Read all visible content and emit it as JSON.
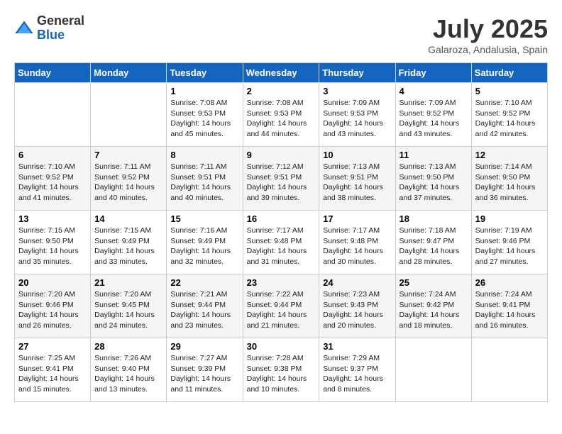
{
  "header": {
    "logo_line1": "General",
    "logo_line2": "Blue",
    "month": "July 2025",
    "location": "Galaroza, Andalusia, Spain"
  },
  "columns": [
    "Sunday",
    "Monday",
    "Tuesday",
    "Wednesday",
    "Thursday",
    "Friday",
    "Saturday"
  ],
  "weeks": [
    [
      {
        "day": "",
        "info": ""
      },
      {
        "day": "",
        "info": ""
      },
      {
        "day": "1",
        "info": "Sunrise: 7:08 AM\nSunset: 9:53 PM\nDaylight: 14 hours and 45 minutes."
      },
      {
        "day": "2",
        "info": "Sunrise: 7:08 AM\nSunset: 9:53 PM\nDaylight: 14 hours and 44 minutes."
      },
      {
        "day": "3",
        "info": "Sunrise: 7:09 AM\nSunset: 9:53 PM\nDaylight: 14 hours and 43 minutes."
      },
      {
        "day": "4",
        "info": "Sunrise: 7:09 AM\nSunset: 9:52 PM\nDaylight: 14 hours and 43 minutes."
      },
      {
        "day": "5",
        "info": "Sunrise: 7:10 AM\nSunset: 9:52 PM\nDaylight: 14 hours and 42 minutes."
      }
    ],
    [
      {
        "day": "6",
        "info": "Sunrise: 7:10 AM\nSunset: 9:52 PM\nDaylight: 14 hours and 41 minutes."
      },
      {
        "day": "7",
        "info": "Sunrise: 7:11 AM\nSunset: 9:52 PM\nDaylight: 14 hours and 40 minutes."
      },
      {
        "day": "8",
        "info": "Sunrise: 7:11 AM\nSunset: 9:51 PM\nDaylight: 14 hours and 40 minutes."
      },
      {
        "day": "9",
        "info": "Sunrise: 7:12 AM\nSunset: 9:51 PM\nDaylight: 14 hours and 39 minutes."
      },
      {
        "day": "10",
        "info": "Sunrise: 7:13 AM\nSunset: 9:51 PM\nDaylight: 14 hours and 38 minutes."
      },
      {
        "day": "11",
        "info": "Sunrise: 7:13 AM\nSunset: 9:50 PM\nDaylight: 14 hours and 37 minutes."
      },
      {
        "day": "12",
        "info": "Sunrise: 7:14 AM\nSunset: 9:50 PM\nDaylight: 14 hours and 36 minutes."
      }
    ],
    [
      {
        "day": "13",
        "info": "Sunrise: 7:15 AM\nSunset: 9:50 PM\nDaylight: 14 hours and 35 minutes."
      },
      {
        "day": "14",
        "info": "Sunrise: 7:15 AM\nSunset: 9:49 PM\nDaylight: 14 hours and 33 minutes."
      },
      {
        "day": "15",
        "info": "Sunrise: 7:16 AM\nSunset: 9:49 PM\nDaylight: 14 hours and 32 minutes."
      },
      {
        "day": "16",
        "info": "Sunrise: 7:17 AM\nSunset: 9:48 PM\nDaylight: 14 hours and 31 minutes."
      },
      {
        "day": "17",
        "info": "Sunrise: 7:17 AM\nSunset: 9:48 PM\nDaylight: 14 hours and 30 minutes."
      },
      {
        "day": "18",
        "info": "Sunrise: 7:18 AM\nSunset: 9:47 PM\nDaylight: 14 hours and 28 minutes."
      },
      {
        "day": "19",
        "info": "Sunrise: 7:19 AM\nSunset: 9:46 PM\nDaylight: 14 hours and 27 minutes."
      }
    ],
    [
      {
        "day": "20",
        "info": "Sunrise: 7:20 AM\nSunset: 9:46 PM\nDaylight: 14 hours and 26 minutes."
      },
      {
        "day": "21",
        "info": "Sunrise: 7:20 AM\nSunset: 9:45 PM\nDaylight: 14 hours and 24 minutes."
      },
      {
        "day": "22",
        "info": "Sunrise: 7:21 AM\nSunset: 9:44 PM\nDaylight: 14 hours and 23 minutes."
      },
      {
        "day": "23",
        "info": "Sunrise: 7:22 AM\nSunset: 9:44 PM\nDaylight: 14 hours and 21 minutes."
      },
      {
        "day": "24",
        "info": "Sunrise: 7:23 AM\nSunset: 9:43 PM\nDaylight: 14 hours and 20 minutes."
      },
      {
        "day": "25",
        "info": "Sunrise: 7:24 AM\nSunset: 9:42 PM\nDaylight: 14 hours and 18 minutes."
      },
      {
        "day": "26",
        "info": "Sunrise: 7:24 AM\nSunset: 9:41 PM\nDaylight: 14 hours and 16 minutes."
      }
    ],
    [
      {
        "day": "27",
        "info": "Sunrise: 7:25 AM\nSunset: 9:41 PM\nDaylight: 14 hours and 15 minutes."
      },
      {
        "day": "28",
        "info": "Sunrise: 7:26 AM\nSunset: 9:40 PM\nDaylight: 14 hours and 13 minutes."
      },
      {
        "day": "29",
        "info": "Sunrise: 7:27 AM\nSunset: 9:39 PM\nDaylight: 14 hours and 11 minutes."
      },
      {
        "day": "30",
        "info": "Sunrise: 7:28 AM\nSunset: 9:38 PM\nDaylight: 14 hours and 10 minutes."
      },
      {
        "day": "31",
        "info": "Sunrise: 7:29 AM\nSunset: 9:37 PM\nDaylight: 14 hours and 8 minutes."
      },
      {
        "day": "",
        "info": ""
      },
      {
        "day": "",
        "info": ""
      }
    ]
  ]
}
